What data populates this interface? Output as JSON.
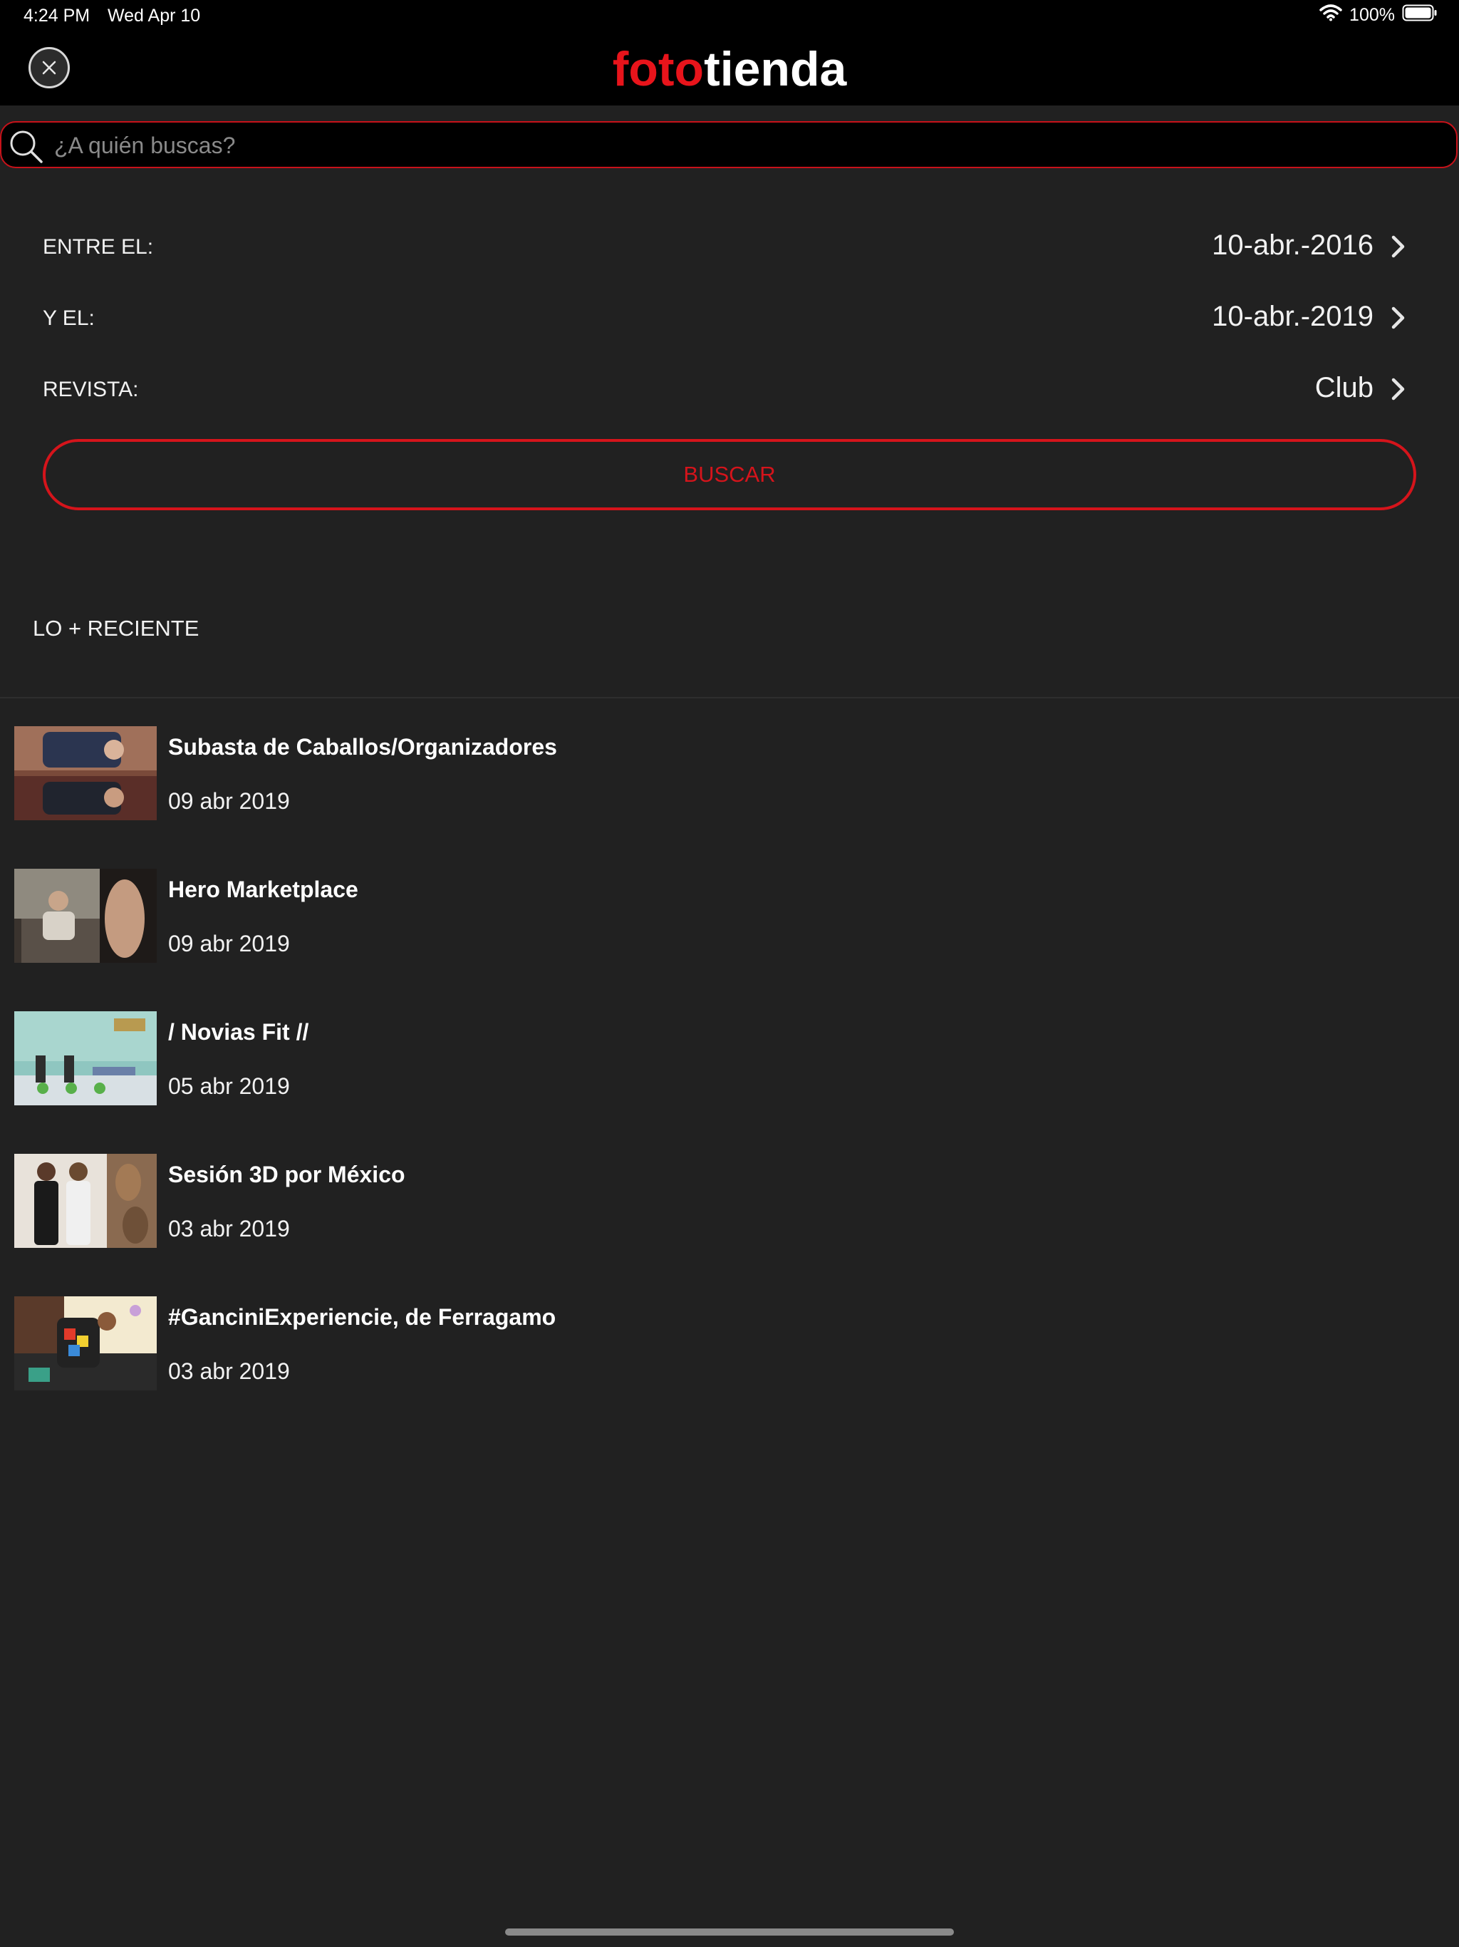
{
  "status": {
    "time": "4:24 PM",
    "date": "Wed Apr 10",
    "battery": "100%"
  },
  "header": {
    "logo_part1": "foto",
    "logo_part2": "tienda",
    "logo_color": "#e8141b"
  },
  "search": {
    "placeholder": "¿A quién buscas?"
  },
  "filters": [
    {
      "label": "ENTRE EL:",
      "value": "10-abr.-2016"
    },
    {
      "label": "Y EL:",
      "value": "10-abr.-2019"
    },
    {
      "label": "REVISTA:",
      "value": "Club"
    }
  ],
  "search_button": {
    "label": "BUSCAR"
  },
  "recent": {
    "title": "LO + RECIENTE",
    "items": [
      {
        "title": "Subasta de Caballos/Organizadores",
        "date": "09 abr 2019"
      },
      {
        "title": "Hero Marketplace",
        "date": "09 abr 2019"
      },
      {
        "title": "/ Novias Fit //",
        "date": "05 abr 2019"
      },
      {
        "title": "Sesión 3D por México",
        "date": "03 abr 2019"
      },
      {
        "title": "#GanciniExperiencie, de Ferragamo",
        "date": "03 abr 2019"
      }
    ]
  },
  "colors": {
    "accent": "#d5141b",
    "background": "#212121",
    "bar": "#000000"
  }
}
